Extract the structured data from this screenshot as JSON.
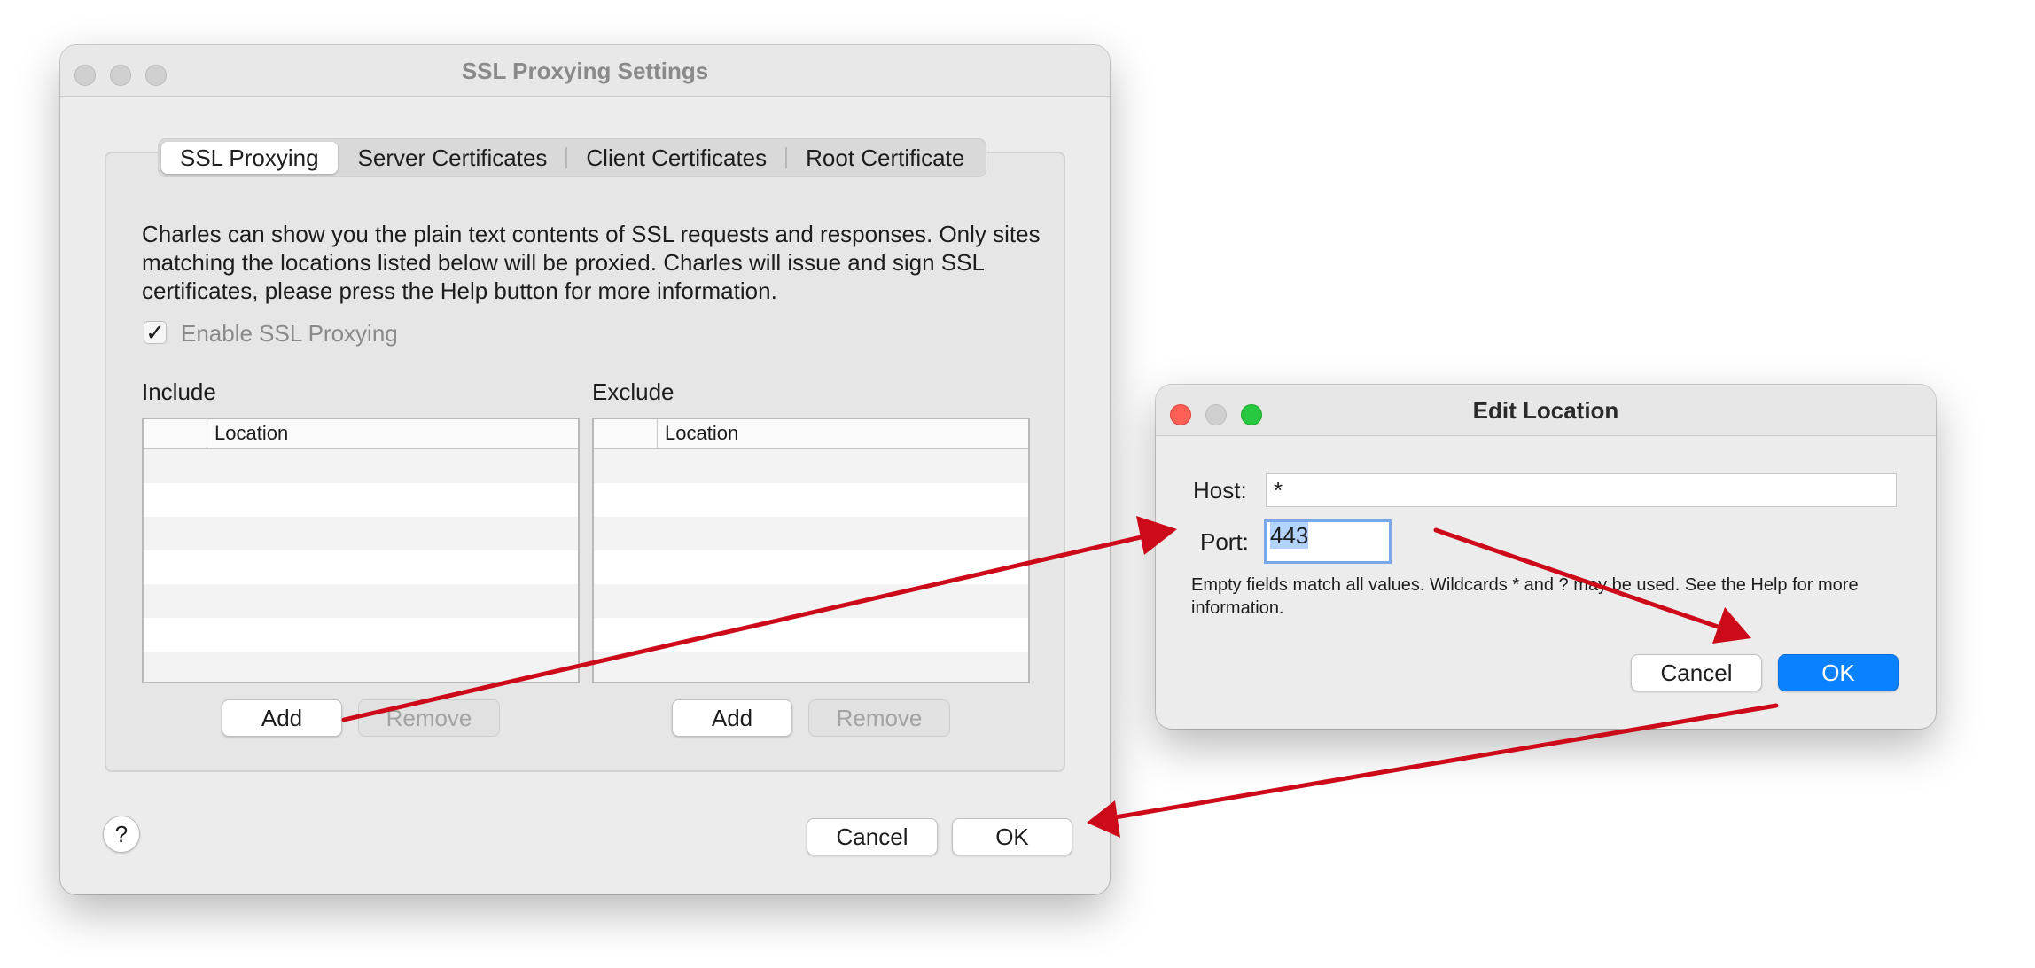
{
  "main_window": {
    "title": "SSL Proxying Settings",
    "tabs": [
      {
        "label": "SSL Proxying",
        "active": true
      },
      {
        "label": "Server Certificates",
        "active": false
      },
      {
        "label": "Client Certificates",
        "active": false
      },
      {
        "label": "Root Certificate",
        "active": false
      }
    ],
    "description": "Charles can show you the plain text contents of SSL requests and responses. Only sites matching the locations listed below will be proxied. Charles will issue and sign SSL certificates, please press the Help button for more information.",
    "enable_checkbox": {
      "label": "Enable SSL Proxying",
      "checked": true,
      "check_glyph": "✓"
    },
    "include": {
      "label": "Include",
      "column": "Location",
      "add_label": "Add",
      "remove_label": "Remove"
    },
    "exclude": {
      "label": "Exclude",
      "column": "Location",
      "add_label": "Add",
      "remove_label": "Remove"
    },
    "help_label": "?",
    "cancel_label": "Cancel",
    "ok_label": "OK"
  },
  "edit_dialog": {
    "title": "Edit Location",
    "host_label": "Host:",
    "host_value": "*",
    "port_label": "Port:",
    "port_value": "443",
    "note": "Empty fields match all values. Wildcards * and ? may be used. See the Help for more information.",
    "cancel_label": "Cancel",
    "ok_label": "OK"
  },
  "colors": {
    "arrow": "#cc0a1a",
    "close": "#fe5f57",
    "minimize": "#d0d0d0",
    "zoom": "#28c840",
    "primary_button": "#0a82ff"
  }
}
